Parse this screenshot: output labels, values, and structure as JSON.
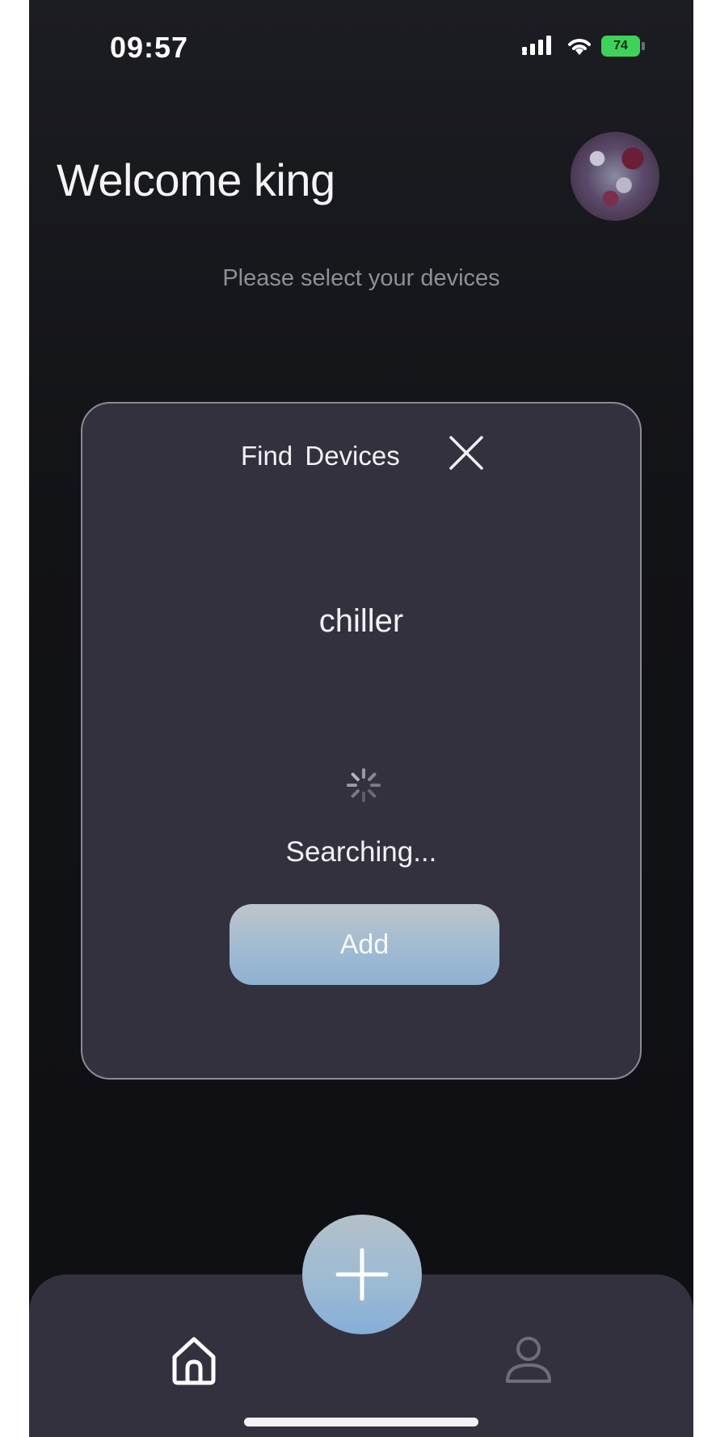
{
  "status_bar": {
    "time": "09:57",
    "battery_level": "74"
  },
  "header": {
    "welcome": "Welcome king",
    "subtitle": "Please select your devices"
  },
  "dialog": {
    "title": "Find  Devices",
    "device_name": "chiller",
    "status": "Searching...",
    "add_label": "Add"
  },
  "nav": {
    "items": [
      "home-icon",
      "add-icon",
      "profile-icon"
    ]
  },
  "colors": {
    "background": "#121317",
    "card": "#34313f",
    "accent": "#9bbad4",
    "battery": "#3fd25a"
  }
}
